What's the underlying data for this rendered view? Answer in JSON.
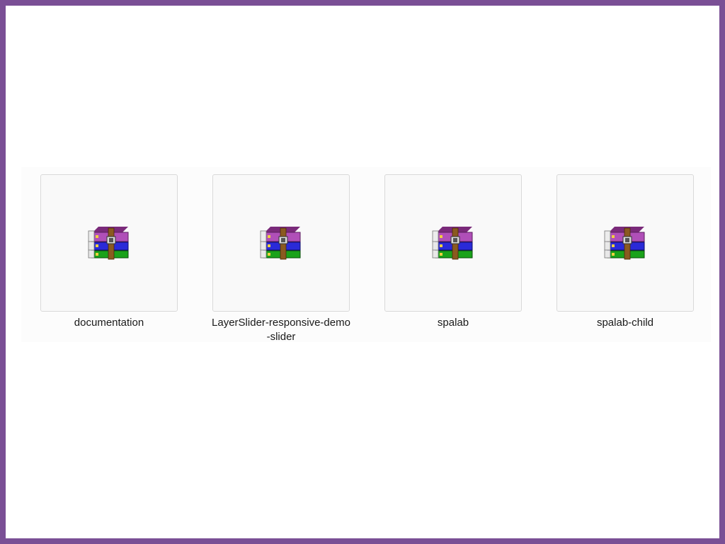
{
  "files": [
    {
      "name": "documentation",
      "icon": "winrar-archive-icon"
    },
    {
      "name": "LayerSlider-responsive-demo-slider",
      "icon": "winrar-archive-icon"
    },
    {
      "name": "spalab",
      "icon": "winrar-archive-icon"
    },
    {
      "name": "spalab-child",
      "icon": "winrar-archive-icon"
    }
  ],
  "colors": {
    "frame_border": "#7a4f95",
    "book_top": "#b04fb8",
    "book_middle": "#2a2ad8",
    "book_bottom": "#1aa21a",
    "strap": "#8a5a20"
  }
}
